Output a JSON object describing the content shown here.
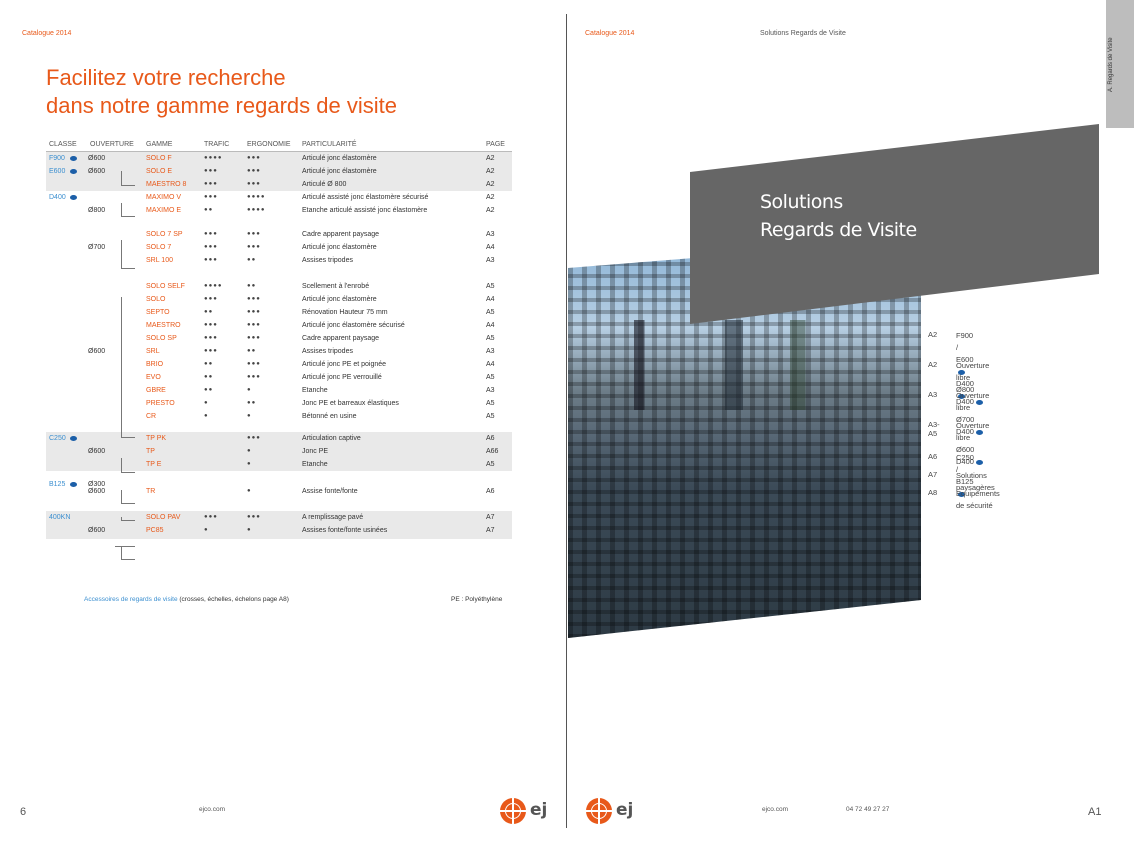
{
  "left": {
    "catalogue": "Catalogue 2014",
    "title_line1": "Facilitez votre recherche",
    "title_line2": "dans notre gamme regards de visite",
    "headers": {
      "classe": "CLASSE",
      "ouverture": "OUVERTURE",
      "gamme": "GAMME",
      "trafic": "TRAFIC",
      "ergonomie": "ERGONOMIE",
      "particularite": "PARTICULARITÉ",
      "page": "PAGE"
    },
    "rows": [
      {
        "classe": "F900",
        "badge": true,
        "ouverture": "Ø600",
        "gamme": "SOLO F",
        "trafic": "●●●●",
        "ergo": "●●●",
        "part": "Articulé jonc élastomère",
        "page": "A2"
      },
      {
        "classe": "E600",
        "badge": true,
        "ouverture": "Ø600",
        "gamme": "SOLO E",
        "trafic": "●●●",
        "ergo": "●●●",
        "part": "Articulé jonc élastomère",
        "page": "A2"
      },
      {
        "classe": "",
        "ouverture": "",
        "gamme": "MAESTRO 8",
        "trafic": "●●●",
        "ergo": "●●●",
        "part": "Articulé Ø 800",
        "page": "A2"
      },
      {
        "classe": "D400",
        "badge": true,
        "ouverture": "",
        "gamme": "MAXIMO V",
        "trafic": "●●●",
        "ergo": "●●●●",
        "part": "Articulé assisté jonc élastomère sécurisé",
        "page": "A2"
      },
      {
        "classe": "",
        "ouverture": "Ø800",
        "gamme": "MAXIMO E",
        "trafic": "●●",
        "ergo": "●●●●",
        "part": "Etanche articulé assisté jonc élastomère",
        "page": "A2"
      },
      {
        "classe": "",
        "ouverture": "",
        "gamme": "SOLO 7 SP",
        "trafic": "●●●",
        "ergo": "●●●",
        "part": "Cadre apparent paysage",
        "page": "A3"
      },
      {
        "classe": "",
        "ouverture": "Ø700",
        "gamme": "SOLO 7",
        "trafic": "●●●",
        "ergo": "●●●",
        "part": "Articulé jonc élastomère",
        "page": "A4"
      },
      {
        "classe": "",
        "ouverture": "",
        "gamme": "SRL 100",
        "trafic": "●●●",
        "ergo": "●●",
        "part": "Assises tripodes",
        "page": "A3"
      },
      {
        "classe": "",
        "ouverture": "",
        "gamme": "SOLO SELF",
        "trafic": "●●●●",
        "ergo": "●●",
        "part": "Scellement à l'enrobé",
        "page": "A5"
      },
      {
        "classe": "",
        "ouverture": "",
        "gamme": "SOLO",
        "trafic": "●●●",
        "ergo": "●●●",
        "part": "Articulé jonc élastomère",
        "page": "A4"
      },
      {
        "classe": "",
        "ouverture": "",
        "gamme": "SEPTO",
        "trafic": "●●",
        "ergo": "●●●",
        "part": "Rénovation Hauteur 75 mm",
        "page": "A5"
      },
      {
        "classe": "",
        "ouverture": "",
        "gamme": "MAESTRO",
        "trafic": "●●●",
        "ergo": "●●●",
        "part": "Articulé jonc élastomère sécurisé",
        "page": "A4"
      },
      {
        "classe": "",
        "ouverture": "",
        "gamme": "SOLO SP",
        "trafic": "●●●",
        "ergo": "●●●",
        "part": "Cadre apparent paysage",
        "page": "A5"
      },
      {
        "classe": "",
        "ouverture": "Ø600",
        "gamme": "SRL",
        "trafic": "●●●",
        "ergo": "●●",
        "part": "Assises tripodes",
        "page": "A3"
      },
      {
        "classe": "",
        "ouverture": "",
        "gamme": "BRIO",
        "trafic": "●●",
        "ergo": "●●●",
        "part": "Articulé jonc PE et poignée",
        "page": "A4"
      },
      {
        "classe": "",
        "ouverture": "",
        "gamme": "EVO",
        "trafic": "●●",
        "ergo": "●●●",
        "part": "Articulé jonc PE verrouillé",
        "page": "A5"
      },
      {
        "classe": "",
        "ouverture": "",
        "gamme": "GBRE",
        "trafic": "●●",
        "ergo": "●",
        "part": "Etanche",
        "page": "A3"
      },
      {
        "classe": "",
        "ouverture": "",
        "gamme": "PRESTO",
        "trafic": "●",
        "ergo": "●●",
        "part": "Jonc PE et barreaux élastiques",
        "page": "A5"
      },
      {
        "classe": "",
        "ouverture": "",
        "gamme": "CR",
        "trafic": "●",
        "ergo": "●",
        "part": "Bétonné en usine",
        "page": "A5"
      },
      {
        "classe": "C250",
        "badge": true,
        "ouverture": "",
        "gamme": "TP PK",
        "trafic": "",
        "ergo": "●●●",
        "part": "Articulation captive",
        "page": "A6"
      },
      {
        "classe": "",
        "ouverture": "Ø600",
        "gamme": "TP",
        "trafic": "",
        "ergo": "●",
        "part": "Jonc PE",
        "page": "A66"
      },
      {
        "classe": "",
        "ouverture": "",
        "gamme": "TP E",
        "trafic": "",
        "ergo": "●",
        "part": "Etanche",
        "page": "A5"
      },
      {
        "classe": "B125",
        "badge": true,
        "ouverture": "Ø300",
        "gamme": "",
        "trafic": "",
        "ergo": "",
        "part": "",
        "page": ""
      },
      {
        "classe": "",
        "ouverture": "Ø600",
        "gamme": "TR",
        "trafic": "",
        "ergo": "●",
        "part": "Assise fonte/fonte",
        "page": "A6"
      },
      {
        "classe": "400KN",
        "badge": false,
        "ouverture": "",
        "gamme": "SOLO PAV",
        "trafic": "●●●",
        "ergo": "●●●",
        "part": "A remplissage pavé",
        "page": "A7"
      },
      {
        "classe": "",
        "ouverture": "Ø600",
        "gamme": "PC85",
        "trafic": "●",
        "ergo": "●",
        "part": "Assises fonte/fonte usinées",
        "page": "A7"
      }
    ],
    "accessories_link": "Accessoires de regards de visite",
    "accessories_rest": " (crosses, échelles, échelons page A8)",
    "pe_note": "PE : Polyéthylène",
    "page_number": "6",
    "url": "ejco.com"
  },
  "right": {
    "catalogue": "Catalogue 2014",
    "running_head": "Solutions Regards de Visite",
    "tab_label": "A. Regards de Visite",
    "banner_line1": "Solutions",
    "banner_line2": "Regards de Visite",
    "index": [
      {
        "code": "A2",
        "lines": [
          "F900 / E600",
          "D400"
        ]
      },
      {
        "code": "A2",
        "lines": [
          "Ouverture libre Ø800",
          "D400"
        ]
      },
      {
        "code": "A3",
        "lines": [
          "Ouverture libre Ø700",
          "D400"
        ]
      },
      {
        "code": "A3-A5",
        "lines": [
          "Ouverture libre Ø600",
          "D400"
        ]
      },
      {
        "code": "A6",
        "lines": [
          "C250 / B125"
        ]
      },
      {
        "code": "A7",
        "lines": [
          "Solutions paysagères"
        ]
      },
      {
        "code": "A8",
        "lines": [
          "Equipements de sécurité"
        ]
      }
    ],
    "url": "ejco.com",
    "phone": "04 72 49 27 27",
    "page_number": "A1"
  },
  "logo_text": "ej"
}
